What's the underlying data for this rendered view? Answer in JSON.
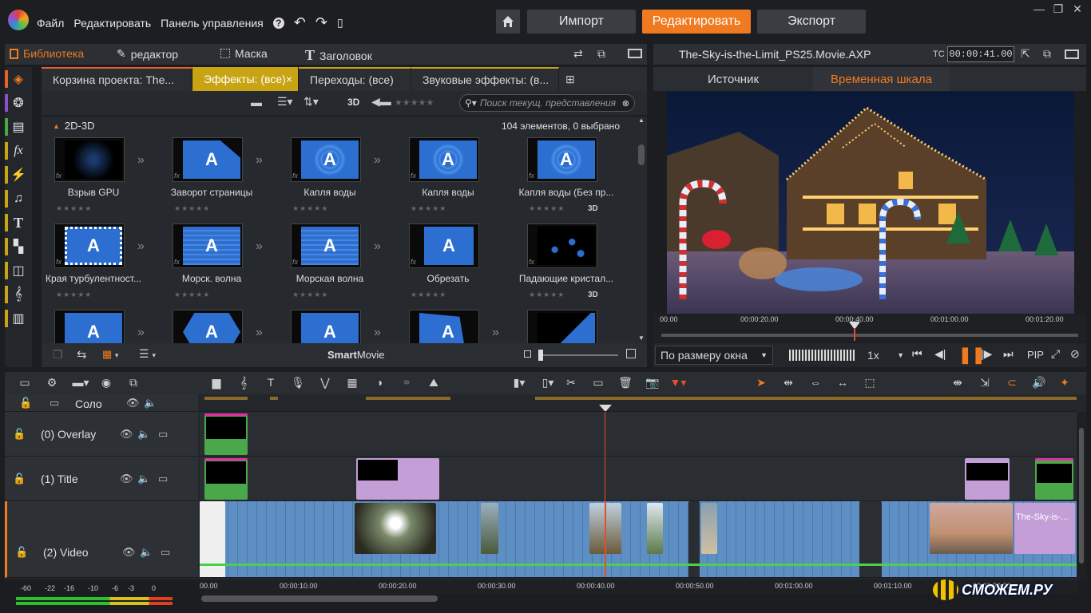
{
  "menu": {
    "file": "Файл",
    "edit": "Редактировать",
    "control_panel": "Панель управления"
  },
  "nav": {
    "import": "Импорт",
    "edit": "Редактировать",
    "export": "Экспорт"
  },
  "library_tabs": {
    "library": "Библиотека",
    "editor": "редактор",
    "mask": "Маска",
    "title": "Заголовок"
  },
  "bin_tabs": [
    {
      "label": "Корзина проекта: The..."
    },
    {
      "label": "Эффекты: (все)",
      "close": "×"
    },
    {
      "label": "Переходы: (все)"
    },
    {
      "label": "Звуковые эффекты: (в..."
    }
  ],
  "lib_toolbar": {
    "view3d": "3D",
    "search_placeholder": "Поиск текущ. представления",
    "rating": "★★★★★"
  },
  "section": {
    "name": "2D-3D",
    "count": "104 элементов, 0 выбрано"
  },
  "effects": [
    {
      "label": "Взрыв GPU",
      "d3": "",
      "style": "dark"
    },
    {
      "label": "Заворот страницы",
      "d3": "",
      "style": "page"
    },
    {
      "label": "Капля воды",
      "d3": "",
      "style": "water"
    },
    {
      "label": "Капля воды",
      "d3": "",
      "style": "water"
    },
    {
      "label": "Капля воды (Без пр...",
      "d3": "3D",
      "style": "water"
    },
    {
      "label": "Края турбулентност...",
      "d3": "",
      "style": "turb"
    },
    {
      "label": "Морск. волна",
      "d3": "",
      "style": "wave"
    },
    {
      "label": "Морская волна",
      "d3": "",
      "style": "wave"
    },
    {
      "label": "Обрезать",
      "d3": "",
      "style": "crop"
    },
    {
      "label": "Падающие кристал...",
      "d3": "3D",
      "style": "crystal"
    },
    {
      "label": "",
      "d3": "",
      "style": "plain"
    },
    {
      "label": "",
      "d3": "",
      "style": "hex"
    },
    {
      "label": "",
      "d3": "",
      "style": "plain"
    },
    {
      "label": "",
      "d3": "",
      "style": "slant"
    },
    {
      "label": "",
      "d3": "",
      "style": "dark2"
    }
  ],
  "thumb_letter": "A",
  "stars": "★★★★★",
  "lib_footer": {
    "smartmovie_bold": "Smart",
    "smartmovie_rest": "Movie"
  },
  "player": {
    "filename": "The-Sky-is-the-Limit_PS25.Movie.AXP",
    "tc_label": "TC",
    "timecode": "00:00:41.00",
    "tab_source": "Источник",
    "tab_timeline": "Временная шкала",
    "ruler": [
      "00.00",
      "00:00:20.00",
      "00:00:40.00",
      "00:01:00.00",
      "00:01:20.00"
    ],
    "fit": "По размеру окна",
    "speed": "1x",
    "pip": "PIP"
  },
  "timeline": {
    "solo": "Соло",
    "tracks": [
      {
        "name": "(0) Overlay"
      },
      {
        "name": "(1) Title"
      },
      {
        "name": "(2) Video"
      }
    ],
    "ruler": [
      "00.00",
      "00:00:10.00",
      "00:00:20.00",
      "00:00:30.00",
      "00:00:40.00",
      "00:00:50.00",
      "00:01:00.00",
      "00:01:10.00",
      "00:01:20.00"
    ],
    "clip_label": "The-Sky-is-...",
    "meter_scale": [
      "-60",
      "-22",
      "-16",
      "-10",
      "-6",
      "-3",
      "0"
    ]
  },
  "watermark": "СМОЖЕМ.РУ",
  "colors": {
    "accent": "#f07a1f",
    "tab_active": "#c8a414",
    "clip_blue": "#5e8fc4",
    "title_purple": "#c49ed6",
    "playhead": "#e0502a"
  }
}
